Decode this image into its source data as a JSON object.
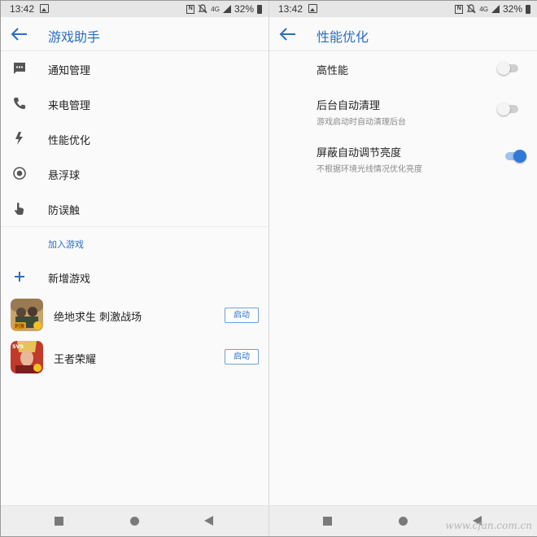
{
  "status": {
    "time": "13:42",
    "network": "4G",
    "nfc_badge": "N",
    "battery": "32%"
  },
  "left": {
    "title": "游戏助手",
    "menu": [
      {
        "label": "通知管理",
        "icon": "message-icon"
      },
      {
        "label": "来电管理",
        "icon": "phone-icon"
      },
      {
        "label": "性能优化",
        "icon": "lightning-icon"
      },
      {
        "label": "悬浮球",
        "icon": "floating-ball-icon"
      },
      {
        "label": "防误触",
        "icon": "touch-hand-icon"
      }
    ],
    "section_label": "加入游戏",
    "add_game_label": "新增游戏",
    "games": [
      {
        "name": "绝地求生 刺激战场",
        "button": "启动",
        "icon_text": "刺激"
      },
      {
        "name": "王者荣耀",
        "button": "启动",
        "icon_text": "5V5"
      }
    ]
  },
  "right": {
    "title": "性能优化",
    "settings": [
      {
        "title": "高性能",
        "subtitle": "",
        "enabled": false
      },
      {
        "title": "后台自动清理",
        "subtitle": "游戏启动时自动清理后台",
        "enabled": false
      },
      {
        "title": "屏蔽自动调节亮度",
        "subtitle": "不根据环境光线情况优化亮度",
        "enabled": true
      }
    ]
  },
  "watermark": "www.cfan.com.cn",
  "colors": {
    "accent": "#2a6fc0",
    "toggle_on": "#2f7ad6",
    "toggle_off": "#cfcfcf"
  }
}
